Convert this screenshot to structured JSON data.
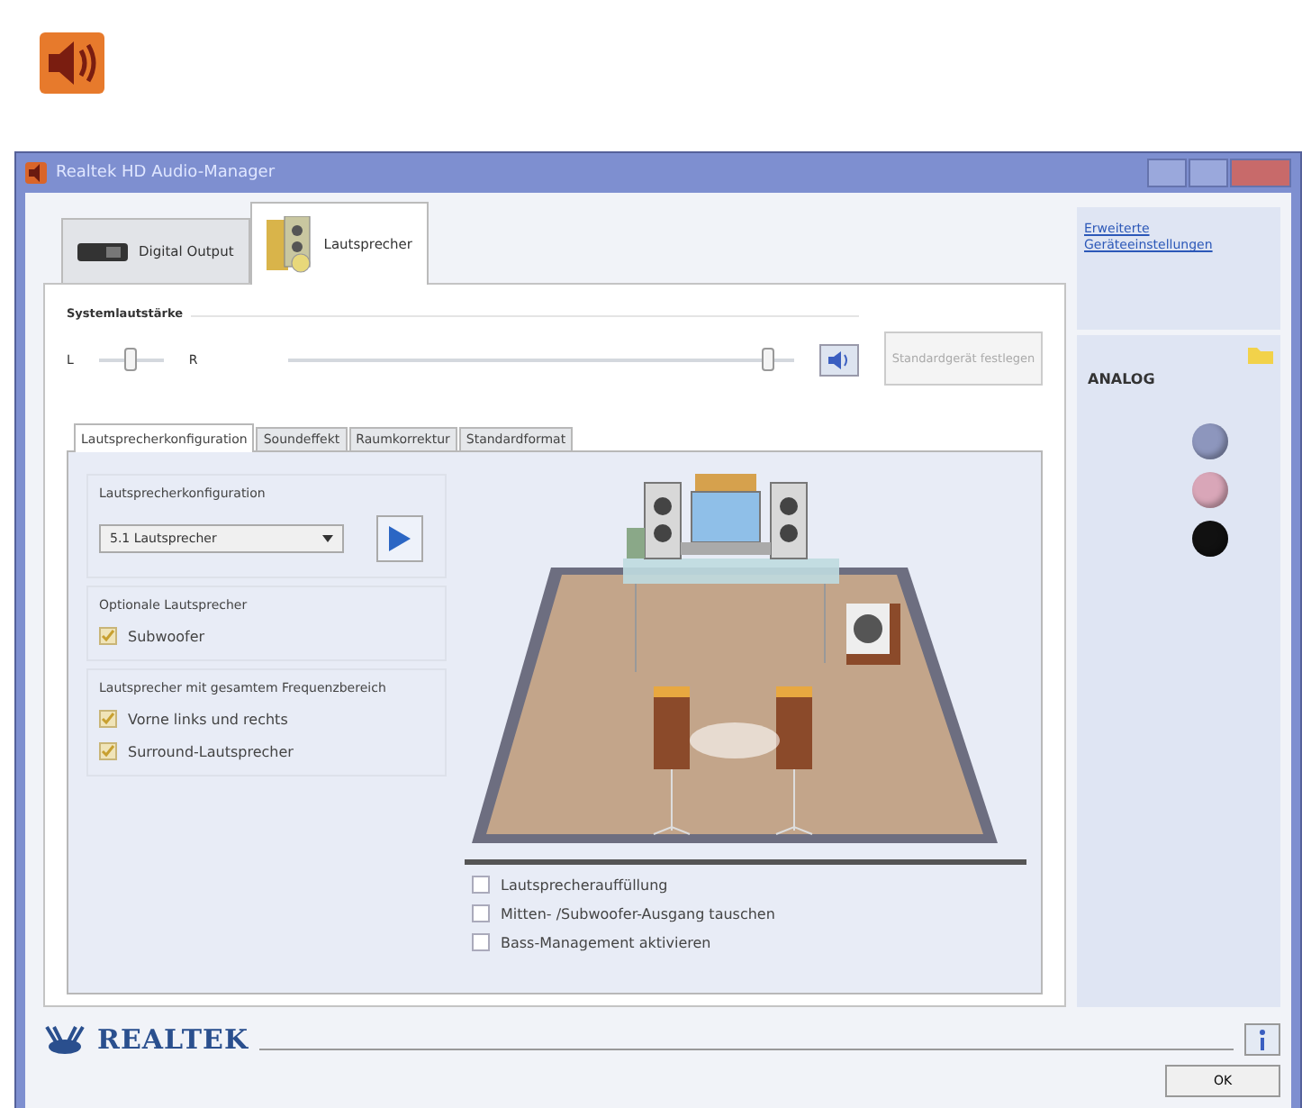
{
  "window": {
    "title": "Realtek HD Audio-Manager"
  },
  "device_tabs": [
    {
      "label": "Digital Output",
      "kind": "digital",
      "selected": false
    },
    {
      "label": "Lautsprecher",
      "kind": "speakers",
      "selected": true
    }
  ],
  "volume": {
    "label": "Systemlautstärke",
    "left": "L",
    "right": "R",
    "balance": {
      "level": 0.5
    },
    "master": {
      "level": 0.95
    },
    "muted": false,
    "default_button": {
      "label": "Standardgerät festlegen",
      "disabled": true
    }
  },
  "sub_tabs": [
    {
      "label": "Lautsprecherkonfiguration",
      "selected": true
    },
    {
      "label": "Soundeffekt",
      "selected": false
    },
    {
      "label": "Raumkorrektur",
      "selected": false
    },
    {
      "label": "Standardformat",
      "selected": false
    }
  ],
  "config": {
    "label": "Lautsprecherkonfiguration",
    "value": "5.1 Lautsprecher"
  },
  "groups": [
    {
      "label": "Optionale Lautsprecher",
      "options": [
        {
          "label": "Subwoofer",
          "checked": true
        }
      ]
    },
    {
      "label": "Lautsprecher mit gesamtem Frequenzbereich",
      "options": [
        {
          "label": "Vorne links und rechts",
          "checked": true
        },
        {
          "label": "Surround-Lautsprecher",
          "checked": true
        }
      ]
    }
  ],
  "extra_options": [
    {
      "label": "Lautsprecherauffüllung",
      "checked": false
    },
    {
      "label": "Mitten- /Subwoofer-Ausgang tauschen",
      "checked": false
    },
    {
      "label": "Bass-Management aktivieren",
      "checked": false
    }
  ],
  "side_panel": {
    "link": "Erweiterte Geräteeinstellungen",
    "section": "ANALOG",
    "jacks": [
      {
        "color": "#8d96bd"
      },
      {
        "color": "#d9a6b8"
      },
      {
        "color": "#111111"
      }
    ]
  },
  "footer": {
    "brand": "REALTEK",
    "ok": "OK"
  }
}
